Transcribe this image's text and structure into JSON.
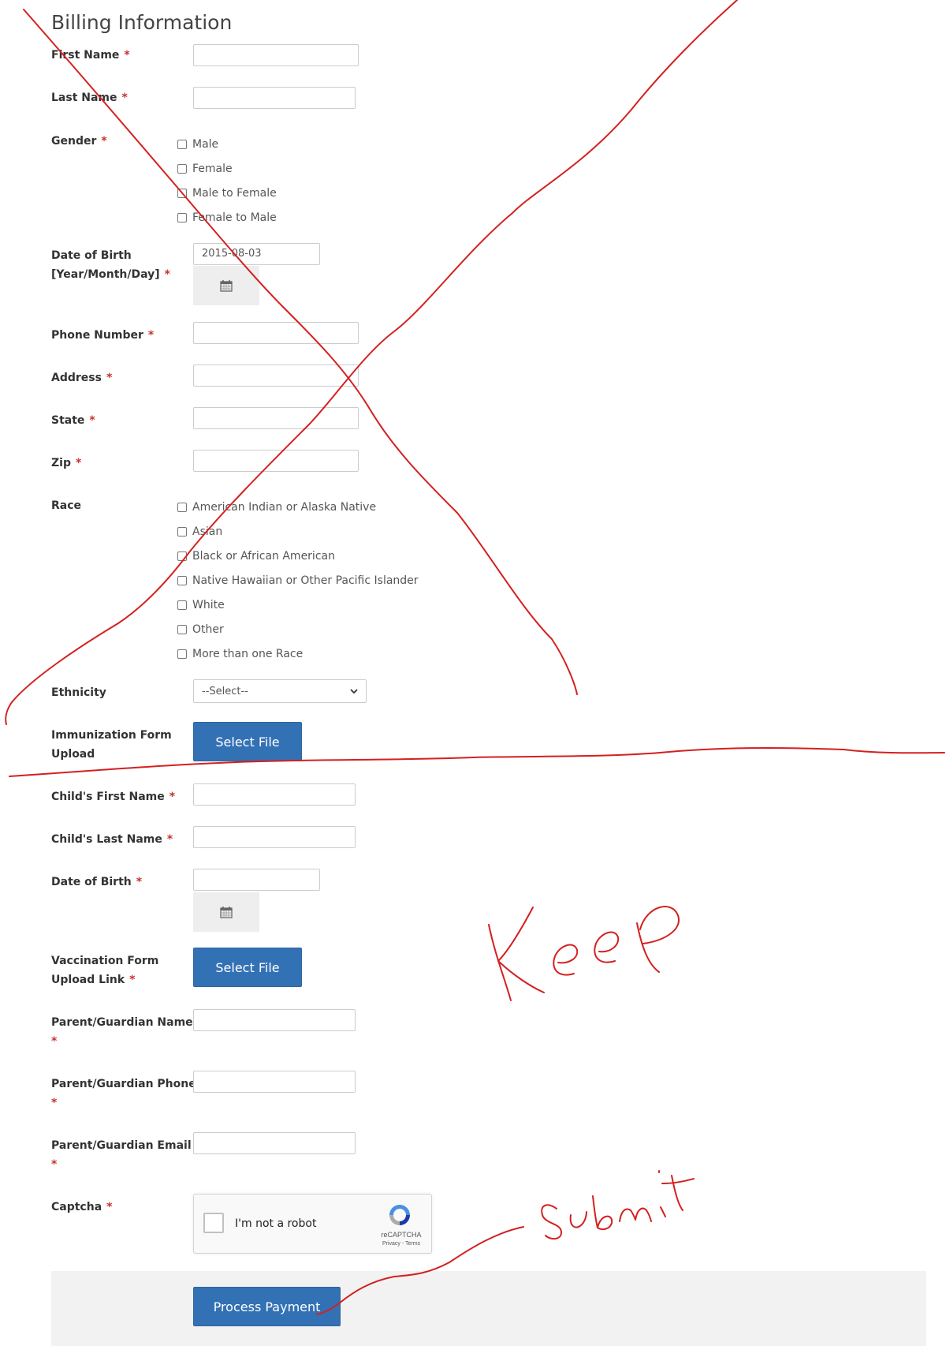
{
  "title": "Billing Information",
  "required_mark": "*",
  "fields": {
    "first_name": "First Name",
    "last_name": "Last Name",
    "gender": "Gender",
    "dob_line1": "Date of Birth",
    "dob_line2": "[Year/Month/Day]",
    "dob_value": "2015-08-03",
    "phone": "Phone Number",
    "address": "Address",
    "state": "State",
    "zip": "Zip",
    "race": "Race",
    "ethnicity": "Ethnicity",
    "ethnicity_selected": "--Select--",
    "immunization_line1": "Immunization Form",
    "immunization_line2": "Upload",
    "child_first": "Child's First Name",
    "child_last": "Child's Last Name",
    "child_dob": "Date of Birth",
    "vaccination_line1": "Vaccination Form",
    "vaccination_line2": "Upload Link",
    "parent_name": "Parent/Guardian Name",
    "parent_phone": "Parent/Guardian Phone",
    "parent_email": "Parent/Guardian Email",
    "captcha": "Captcha"
  },
  "gender_options": [
    "Male",
    "Female",
    "Male to Female",
    "Female to Male"
  ],
  "race_options": [
    "American Indian or Alaska Native",
    "Asian",
    "Black or African American",
    "Native Hawaiian or Other Pacific Islander",
    "White",
    "Other",
    "More than one Race"
  ],
  "buttons": {
    "select_file": "Select File",
    "process_payment": "Process Payment"
  },
  "recaptcha": {
    "checkbox_label": "I'm not a robot",
    "brand": "reCAPTCHA",
    "links": "Privacy - Terms"
  },
  "annotations": {
    "keep": "Keep",
    "submit": "Submit",
    "ink_color": "#d42020"
  },
  "icons": [
    "calendar-icon",
    "chevron-down-icon",
    "recaptcha-logo-icon"
  ],
  "colors": {
    "primary_button": "#3371b5",
    "required": "#c9302c",
    "footer_bar": "#f2f2f2"
  }
}
